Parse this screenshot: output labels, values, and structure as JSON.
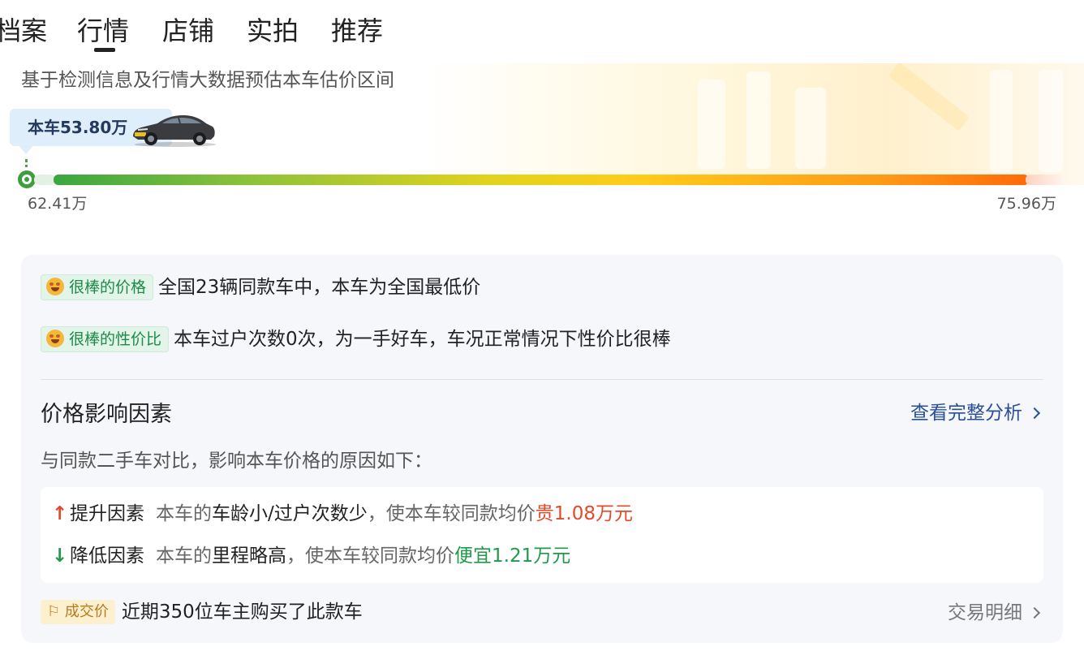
{
  "tabs": [
    {
      "label": "档案"
    },
    {
      "label": "行情"
    },
    {
      "label": "店铺"
    },
    {
      "label": "实拍"
    },
    {
      "label": "推荐"
    }
  ],
  "active_tab": "行情",
  "estimate": {
    "subtitle": "基于检测信息及行情大数据预估本车估价区间",
    "this_car_label": "本车53.80万",
    "low": "62.41万",
    "high": "75.96万"
  },
  "highlights": [
    {
      "badge": "很棒的价格",
      "text": "全国23辆同款车中，本车为全国最低价"
    },
    {
      "badge": "很棒的性价比",
      "text": "本车过户次数0次，为一手好车，车况正常情况下性价比很棒"
    }
  ],
  "factors": {
    "title": "价格影响因素",
    "link": "查看完整分析",
    "desc": "与同款二手车对比，影响本车价格的原因如下：",
    "up": {
      "label": "提升因素",
      "prefix": "本车的",
      "cause": "车龄小/过户次数少",
      "mid": "，使本车较同款均价",
      "effect": "贵1.08万元"
    },
    "down": {
      "label": "降低因素",
      "prefix": "本车的",
      "cause": "里程略高",
      "mid": "，使本车较同款均价",
      "effect": "便宜1.21万元"
    }
  },
  "deal": {
    "badge": "成交价",
    "text": "近期350位车主购买了此款车",
    "link": "交易明细"
  },
  "colors": {
    "good": "#1d8a48",
    "up": "#e24a2c",
    "down": "#1f9a4a",
    "link": "#2a4f9a"
  }
}
